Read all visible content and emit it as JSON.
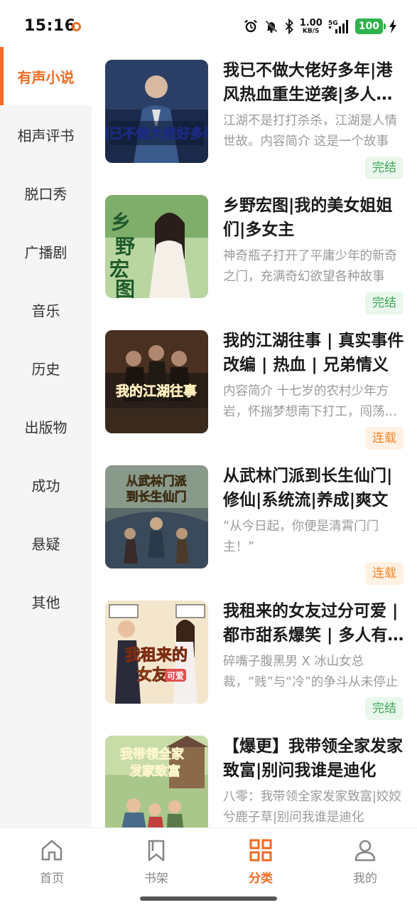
{
  "status_bar": {
    "time": "15:16",
    "net_speed_value": "1.00",
    "net_speed_unit": "KB/S",
    "network": "5G",
    "battery": "100",
    "icons": [
      "alarm-icon",
      "mute-bell-icon",
      "bluetooth-icon",
      "signal-icon",
      "charging-icon"
    ]
  },
  "sidebar": {
    "items": [
      {
        "label": "有声小说",
        "active": true
      },
      {
        "label": "相声评书",
        "active": false
      },
      {
        "label": "脱口秀",
        "active": false
      },
      {
        "label": "广播剧",
        "active": false
      },
      {
        "label": "音乐",
        "active": false
      },
      {
        "label": "历史",
        "active": false
      },
      {
        "label": "出版物",
        "active": false
      },
      {
        "label": "成功",
        "active": false
      },
      {
        "label": "悬疑",
        "active": false
      },
      {
        "label": "其他",
        "active": false
      }
    ]
  },
  "books": [
    {
      "title": "我已不做大佬好多年|港风热血重生逆袭|多人有声剧",
      "desc": "江湖不是打打杀杀，江湖是人情世故。内容简介 这是一个故事",
      "status": "完结",
      "status_type": "done",
      "cover_text": "我已不做大佬好多年",
      "cover_colors": [
        "#1b2a4a",
        "#3b5a8c",
        "#f0c040"
      ]
    },
    {
      "title": "乡野宏图|我的美女姐姐们|多女主",
      "desc": "神奇瓶子打开了平庸少年的新奇之门，充满奇幻欲望各种故事",
      "status": "完结",
      "status_type": "done",
      "cover_text": "乡野宏图",
      "cover_colors": [
        "#7fae6a",
        "#e8e2d0",
        "#1e5a2a"
      ]
    },
    {
      "title": "我的江湖往事 | 真实事件改编 | 热血 | 兄弟情义",
      "desc": "内容简介 十七岁的农村少年方岩，怀揣梦想南下打工，闯荡江湖",
      "status": "连载",
      "status_type": "serial",
      "cover_text": "我的江湖往事",
      "cover_colors": [
        "#2a1e18",
        "#6a4a30",
        "#e0442a"
      ]
    },
    {
      "title": "从武林门派到长生仙门|修仙|系统流|养成|爽文",
      "desc": "“从今日起，你便是清霄门门主！”",
      "status": "连载",
      "status_type": "serial",
      "cover_text": "从武林门派到长生仙门",
      "cover_colors": [
        "#3a4a5a",
        "#7a8a7a",
        "#d9c089"
      ]
    },
    {
      "title": "我租来的女友过分可爱 | 都市甜系爆笑 | 多人有声剧",
      "desc": "碎嘴子腹黑男 X 冰山女总裁，“贱”与“冷”的争斗从未停止",
      "status": "完结",
      "status_type": "done",
      "cover_text": "我租来的女友过分可爱",
      "cover_colors": [
        "#f3e6cc",
        "#e0a050",
        "#c8362a"
      ]
    },
    {
      "title": "【爆更】我带领全家发家致富|别问我谁是迪化",
      "desc": "八零：我带领全家发家致富|姣姣兮鹿子草|别问我谁是迪化",
      "status": "",
      "status_type": "done",
      "cover_text": "我带领全家发家致富",
      "cover_colors": [
        "#a9c78a",
        "#6a9a5a",
        "#d9442a"
      ]
    }
  ],
  "bottom_nav": {
    "items": [
      {
        "label": "首页",
        "icon": "home-icon",
        "active": false
      },
      {
        "label": "书架",
        "icon": "bookmark-icon",
        "active": false
      },
      {
        "label": "分类",
        "icon": "category-grid-icon",
        "active": true
      },
      {
        "label": "我的",
        "icon": "profile-icon",
        "active": false
      }
    ]
  },
  "accent_color": "#f26b21"
}
